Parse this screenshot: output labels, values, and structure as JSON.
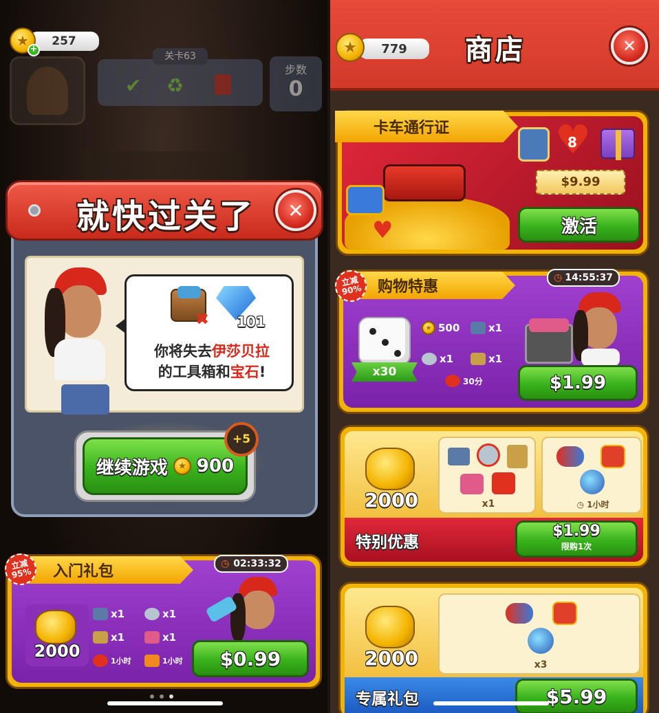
{
  "left": {
    "hud": {
      "coins": "257",
      "level_label": "关卡63",
      "moves_label": "步数",
      "moves_value": "0"
    },
    "modal": {
      "title": "就快过关了",
      "gem_count": "101",
      "message_prefix": "你将失去",
      "message_name": "伊莎贝拉",
      "message_line2_a": "的工具箱和",
      "message_line2_b": "宝石",
      "message_line2_c": "!",
      "continue_label": "继续游戏",
      "continue_cost": "900",
      "bonus": "+5"
    },
    "starter_pack": {
      "title": "入门礼包",
      "discount": "立减\n95%",
      "timer": "02:33:32",
      "coins": "2000",
      "items": [
        "x1",
        "x1",
        "x1",
        "x1",
        "1小时",
        "1小时"
      ],
      "price": "$0.99"
    }
  },
  "right": {
    "header": {
      "coins": "779",
      "title": "商店"
    },
    "truck_pass": {
      "title": "卡车通行证",
      "hearts": "8",
      "price_tag": "$9.99",
      "button": "激活"
    },
    "shopping_deal": {
      "title": "购物特惠",
      "discount": "立减\n90%",
      "timer": "14:55:37",
      "dice": "x30",
      "items": [
        "500",
        "x1",
        "x1",
        "x1"
      ],
      "hearts_time": "30分",
      "price": "$1.99"
    },
    "special_offer": {
      "coins": "2000",
      "tools_count": "x1",
      "boost_time": "1小时",
      "label": "特别优惠",
      "price": "$1.99",
      "limit": "限购1次"
    },
    "exclusive_pack": {
      "coins": "2000",
      "count": "x3",
      "label": "专属礼包",
      "price": "$5.99"
    }
  },
  "colors": {
    "accent_red": "#d9392c",
    "purple": "#8a2fb8",
    "gold": "#f2b400",
    "green": "#3bb521"
  }
}
